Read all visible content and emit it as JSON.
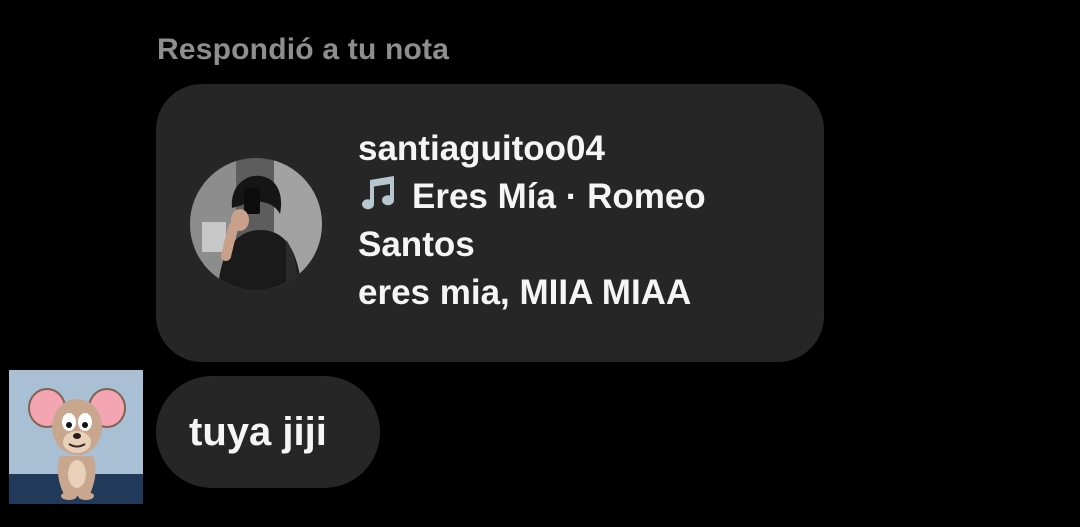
{
  "reply": {
    "caption": "Respondió a tu nota"
  },
  "note": {
    "username": "santiaguitoo04",
    "song": "Eres Mía · Romeo Santos",
    "text": "eres mia, MIIA MIAA",
    "music_icon": "music-note-icon"
  },
  "message": {
    "text": "tuya jiji"
  },
  "colors": {
    "background": "#000000",
    "bubble": "#262626",
    "caption": "#8e8e8e",
    "text": "#f5f5f5",
    "music_icon": "#b7c7cf"
  }
}
